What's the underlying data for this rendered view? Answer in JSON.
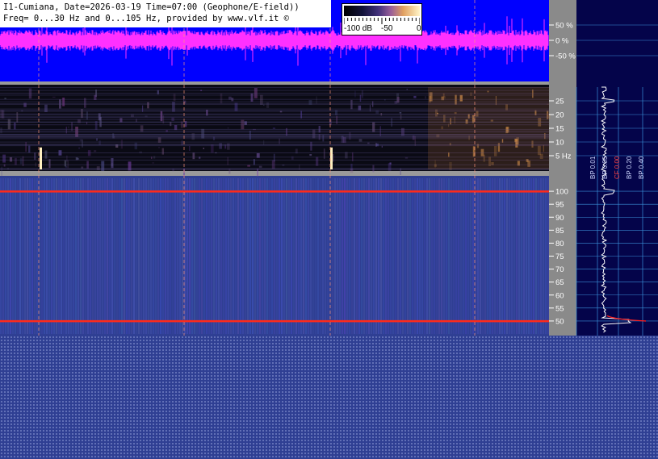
{
  "header": {
    "line1": "I1-Cumiana, Date=2026-03-19 Time=07:00 (Geophone/E-field))",
    "line2": "Freq= 0...30 Hz and 0...105 Hz, provided by www.vlf.it ©"
  },
  "colorbar": {
    "labels": [
      "-100 dB",
      "-50",
      "0"
    ]
  },
  "colors": {
    "waveform_bg": "#0000ff",
    "waveform": "#ff30ff",
    "spectrogram_hi": "#e8a050",
    "line_red": "#ff2a1a",
    "bottom_bg": "#2f3f93"
  },
  "chart_data": [
    {
      "type": "line",
      "title": "",
      "ylim": [
        -100,
        100
      ],
      "yticks": [
        "50 %",
        "0 %",
        "-50 %"
      ],
      "ytick_values": [
        50,
        0,
        -50
      ]
    },
    {
      "type": "heatmap",
      "ylim": [
        0,
        30
      ],
      "yticks": [
        "25",
        "20",
        "15",
        "10",
        "5 Hz"
      ],
      "ytick_values": [
        25,
        20,
        15,
        10,
        5
      ]
    },
    {
      "type": "heatmap",
      "ylim": [
        45,
        105
      ],
      "yticks": [
        "100",
        "95",
        "90",
        "85",
        "80",
        "75",
        "70",
        "65",
        "60",
        "55",
        "50"
      ],
      "ytick_values": [
        100,
        95,
        90,
        85,
        80,
        75,
        70,
        65,
        60,
        55,
        50
      ],
      "features": [
        {
          "label": "line",
          "freq_hz": 100
        },
        {
          "label": "line",
          "freq_hz": 50
        }
      ]
    }
  ],
  "side_labels": [
    {
      "text": "BP 0.01",
      "color": "#cfd8ff"
    },
    {
      "text": "BP 0.05",
      "color": "#cfd8ff"
    },
    {
      "text": "CF 0.00",
      "color": "#ff4040"
    },
    {
      "text": "BP 0.20",
      "color": "#cfd8ff"
    },
    {
      "text": "BP 0.40",
      "color": "#cfd8ff"
    }
  ]
}
